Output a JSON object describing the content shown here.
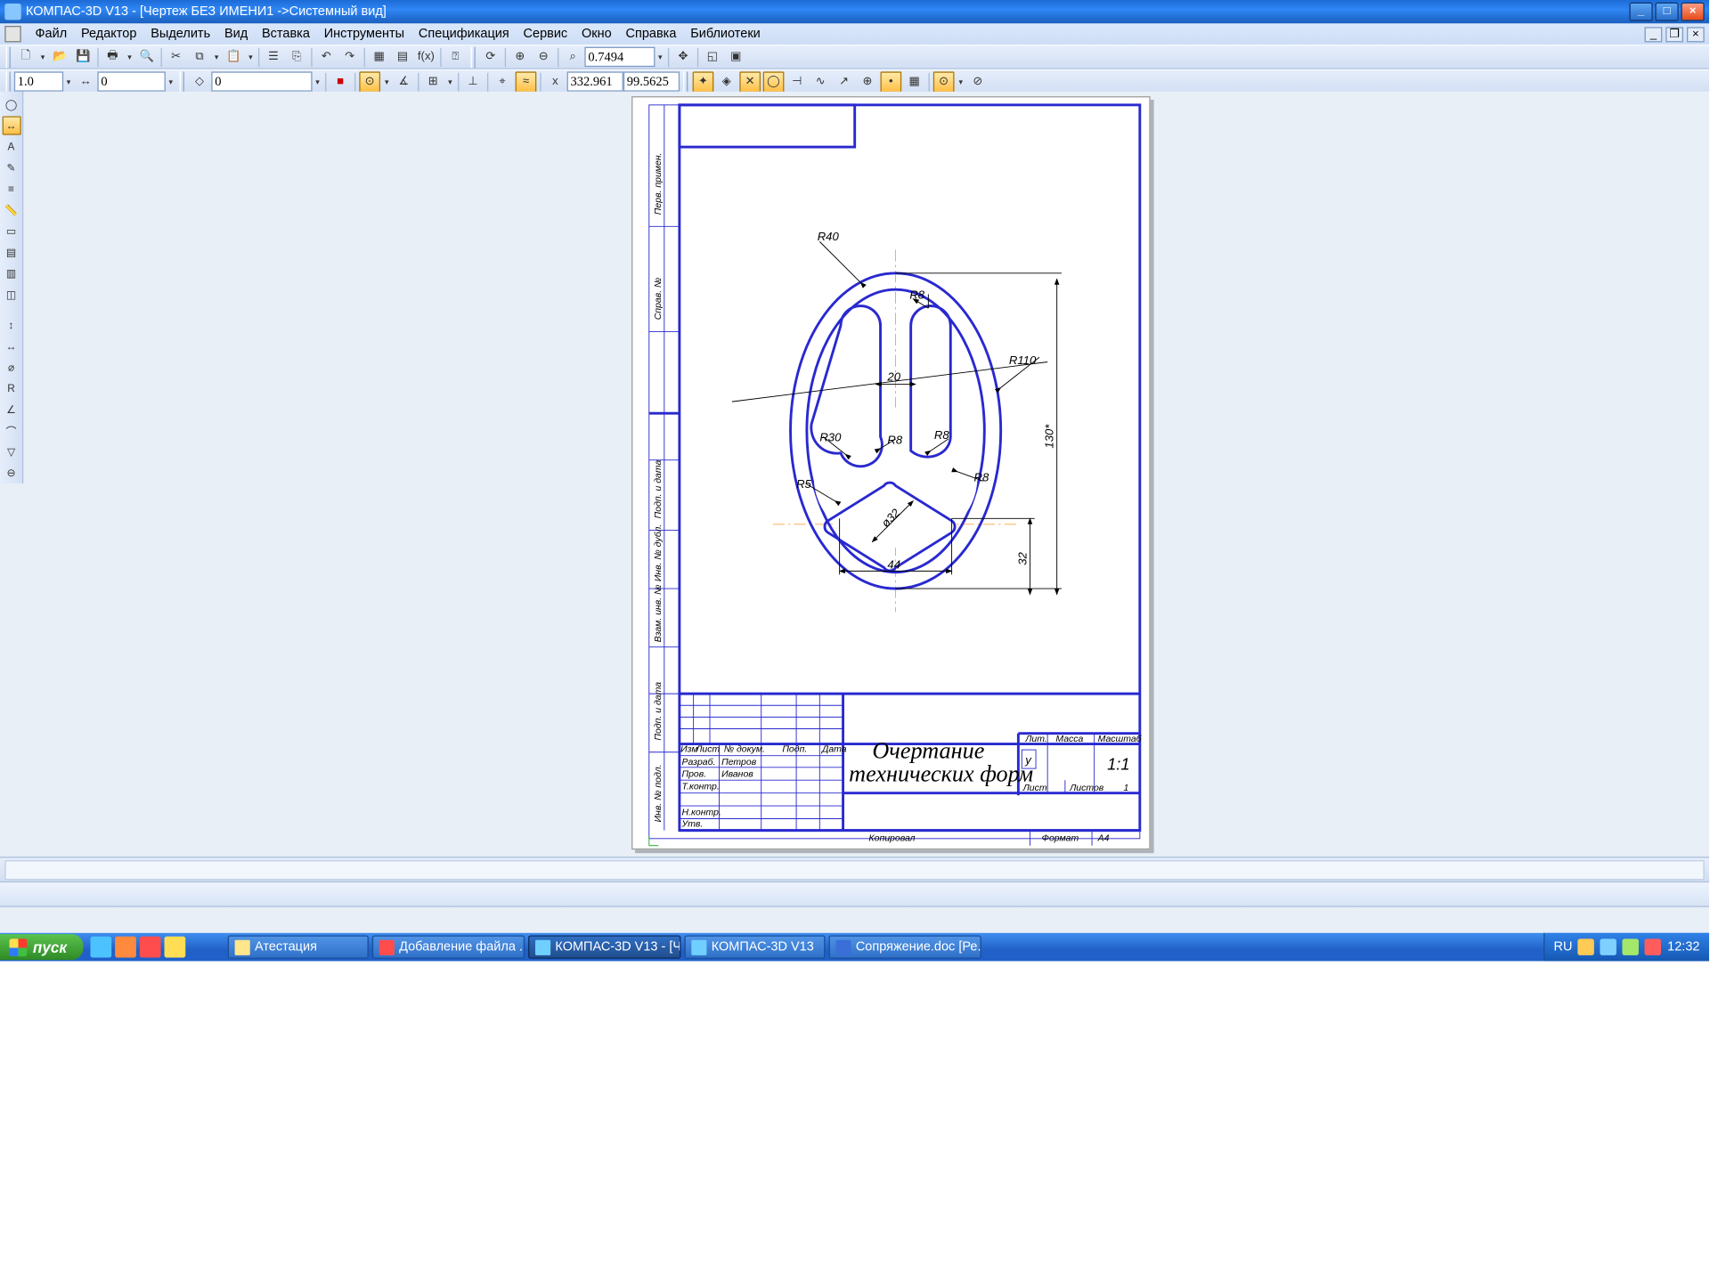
{
  "titlebar": {
    "text": "КОМПАС-3D V13 - [Чертеж БЕЗ ИМЕНИ1 ->Системный вид]"
  },
  "menu": {
    "items": [
      "Файл",
      "Редактор",
      "Выделить",
      "Вид",
      "Вставка",
      "Инструменты",
      "Спецификация",
      "Сервис",
      "Окно",
      "Справка",
      "Библиотеки"
    ]
  },
  "toolbar1": {
    "zoom": "0.7494"
  },
  "toolbar2": {
    "style": "1.0",
    "val_a": "0",
    "layer": "0",
    "coord_x": "332.961",
    "coord_y": "99.5625"
  },
  "drawing": {
    "labels": {
      "r40": "R40",
      "r8a": "R8",
      "r110": "R110",
      "r30": "R30",
      "r8b": "R8",
      "r8c": "R8",
      "r8d": "R8",
      "r5": "R5",
      "d20": "20",
      "d32": "ø32",
      "d44": "44",
      "d130": "130*",
      "d32h": "32"
    },
    "titleblock": {
      "title1": "Очертание",
      "title2": "технических форм",
      "row_hdr": [
        "Изм",
        "Лист",
        "№ докум.",
        "Подп.",
        "Дата"
      ],
      "rows": {
        "r1": [
          "Разраб.",
          "Петров"
        ],
        "r2": [
          "Пров.",
          "Иванов"
        ],
        "r3": [
          "Т.контр.",
          ""
        ],
        "r4": [
          "Н.контр.",
          ""
        ],
        "r5": [
          "Утв.",
          ""
        ]
      },
      "lit": "Лит.",
      "massa": "Масса",
      "masht": "Масштаб",
      "scale": "1:1",
      "u": "у",
      "list": "Лист",
      "listov": "Листов",
      "listov_n": "1",
      "kopir": "Копировал",
      "format": "Формат",
      "format_v": "A4"
    },
    "side_labels": [
      "Перв. примен.",
      "Справ. №",
      "Подп. и дата",
      "Инв. № дубл.",
      "Взам. инв. №",
      "Подп. и дата",
      "Инв. № подл."
    ]
  },
  "taskbar": {
    "start": "пуск",
    "tasks": [
      "Атестация",
      "Добавление файла ...",
      "КОМПАС-3D V13 - [Ч...",
      "КОМПАС-3D V13",
      "Сопряжение.doc [Ре..."
    ],
    "lang": "RU",
    "clock": "12:32"
  }
}
